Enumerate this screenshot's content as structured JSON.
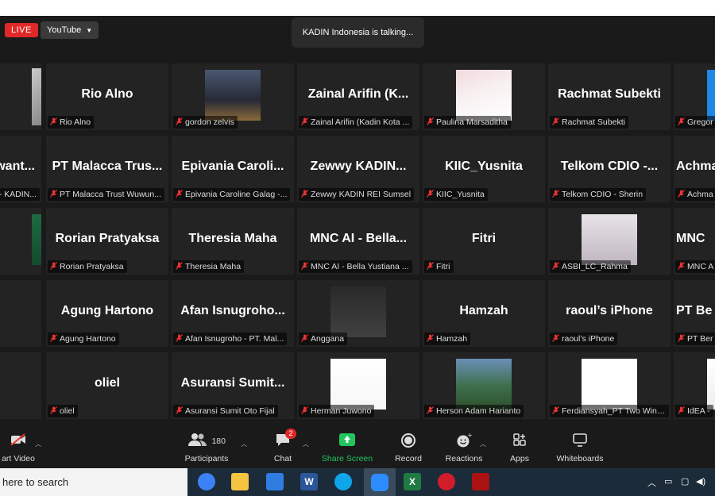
{
  "header": {
    "live_label": "LIVE",
    "stream_target": "YouTube",
    "talking_indicator": "KADIN Indonesia is talking..."
  },
  "participants": [
    {
      "name": "",
      "label": ""
    },
    {
      "name": "Rio Alno",
      "label": "Rio Alno"
    },
    {
      "name": "",
      "label": "gordon zelvis"
    },
    {
      "name": "Zainal Arifin (K...",
      "label": "Zainal Arifin (Kadin Kota ..."
    },
    {
      "name": "",
      "label": "Paulina Marsaditha"
    },
    {
      "name": "Rachmat Subekti",
      "label": "Rachmat Subekti"
    },
    {
      "name": "",
      "label": "Gregor"
    },
    {
      "name": "want...",
      "label": "- KADIN..."
    },
    {
      "name": "PT Malacca Trus...",
      "label": "PT Malacca Trust Wuwun..."
    },
    {
      "name": "Epivania Caroli...",
      "label": "Epivania Caroline Galag -..."
    },
    {
      "name": "Zewwy KADIN...",
      "label": "Zewwy KADIN REI Sumsel"
    },
    {
      "name": "KIIC_Yusnita",
      "label": "KIIC_Yusnita"
    },
    {
      "name": "Telkom CDIO -...",
      "label": "Telkom CDIO - Sherin"
    },
    {
      "name": "Achma",
      "label": "Achma"
    },
    {
      "name": "",
      "label": ""
    },
    {
      "name": "Rorian Pratyaksa",
      "label": "Rorian Pratyaksa"
    },
    {
      "name": "Theresia Maha",
      "label": "Theresia Maha"
    },
    {
      "name": "MNC AI - Bella...",
      "label": "MNC AI - Bella Yustiana ..."
    },
    {
      "name": "Fitri",
      "label": "Fitri"
    },
    {
      "name": "",
      "label": "ASBI_LC_Rahma"
    },
    {
      "name": "MNC",
      "label": "MNC A"
    },
    {
      "name": "",
      "label": ""
    },
    {
      "name": "Agung Hartono",
      "label": "Agung Hartono"
    },
    {
      "name": "Afan Isnugroho...",
      "label": "Afan Isnugroho - PT. Mal..."
    },
    {
      "name": "",
      "label": "Anggana"
    },
    {
      "name": "Hamzah",
      "label": "Hamzah"
    },
    {
      "name": "raoul’s iPhone",
      "label": "raoul’s iPhone"
    },
    {
      "name": "PT Be",
      "label": "PT Ber"
    },
    {
      "name": "",
      "label": ""
    },
    {
      "name": "oliel",
      "label": "oliel"
    },
    {
      "name": "Asuransi Sumit...",
      "label": "Asuransi Sumit Oto Fijal"
    },
    {
      "name": "",
      "label": "Herman Juwono"
    },
    {
      "name": "",
      "label": "Herson Adam Harianto"
    },
    {
      "name": "",
      "label": "Ferdiansyah_PT Two Win ..."
    },
    {
      "name": "",
      "label": "IdEA -"
    }
  ],
  "toolbar": {
    "start_video": "art Video",
    "participants_label": "Participants",
    "participants_count": "180",
    "chat_label": "Chat",
    "chat_badge": "2",
    "share_label": "Share Screen",
    "record_label": "Record",
    "reactions_label": "Reactions",
    "apps_label": "Apps",
    "whiteboards_label": "Whiteboards"
  },
  "taskbar": {
    "search_text": "here to search"
  },
  "colors": {
    "share_green": "#22c55e",
    "live_red": "#e02828",
    "muted_red": "#e33333"
  }
}
